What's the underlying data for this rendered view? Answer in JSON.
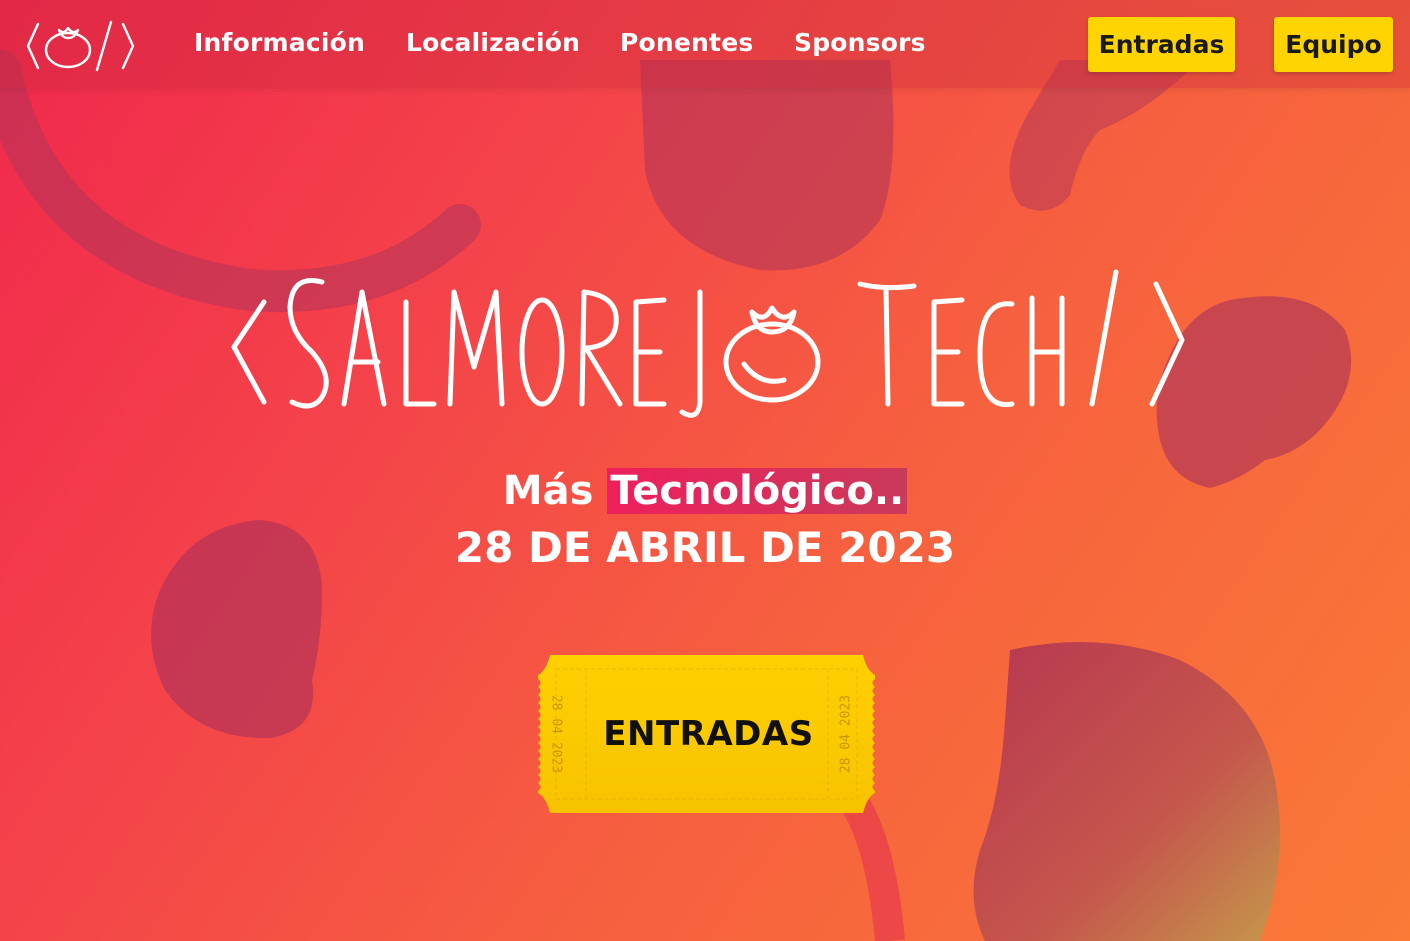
{
  "nav": {
    "logo_label": "SalmorejoTech",
    "links": [
      {
        "label": "Información"
      },
      {
        "label": "Localización"
      },
      {
        "label": "Ponentes"
      },
      {
        "label": "Sponsors"
      }
    ],
    "buttons": [
      {
        "label": "Entradas"
      },
      {
        "label": "Equipo"
      }
    ]
  },
  "hero": {
    "title": "<SalmorejoTech/>",
    "tagline_prefix": "Más",
    "tagline_highlight": "Tecnológico..",
    "date": "28 DE ABRIL DE 2023",
    "cta_label": "ENTRADAS",
    "ticket_stub_left": "28 04 2023",
    "ticket_stub_right": "28 04 2023"
  },
  "colors": {
    "accent_yellow": "#ffd400",
    "background_red": "#f0284c",
    "background_orange": "#fa7a36",
    "blob": "#b0345a",
    "highlight": "#ee1f5c",
    "text": "#ffffff"
  },
  "icons": {
    "logo": "tomato-code-icon"
  }
}
